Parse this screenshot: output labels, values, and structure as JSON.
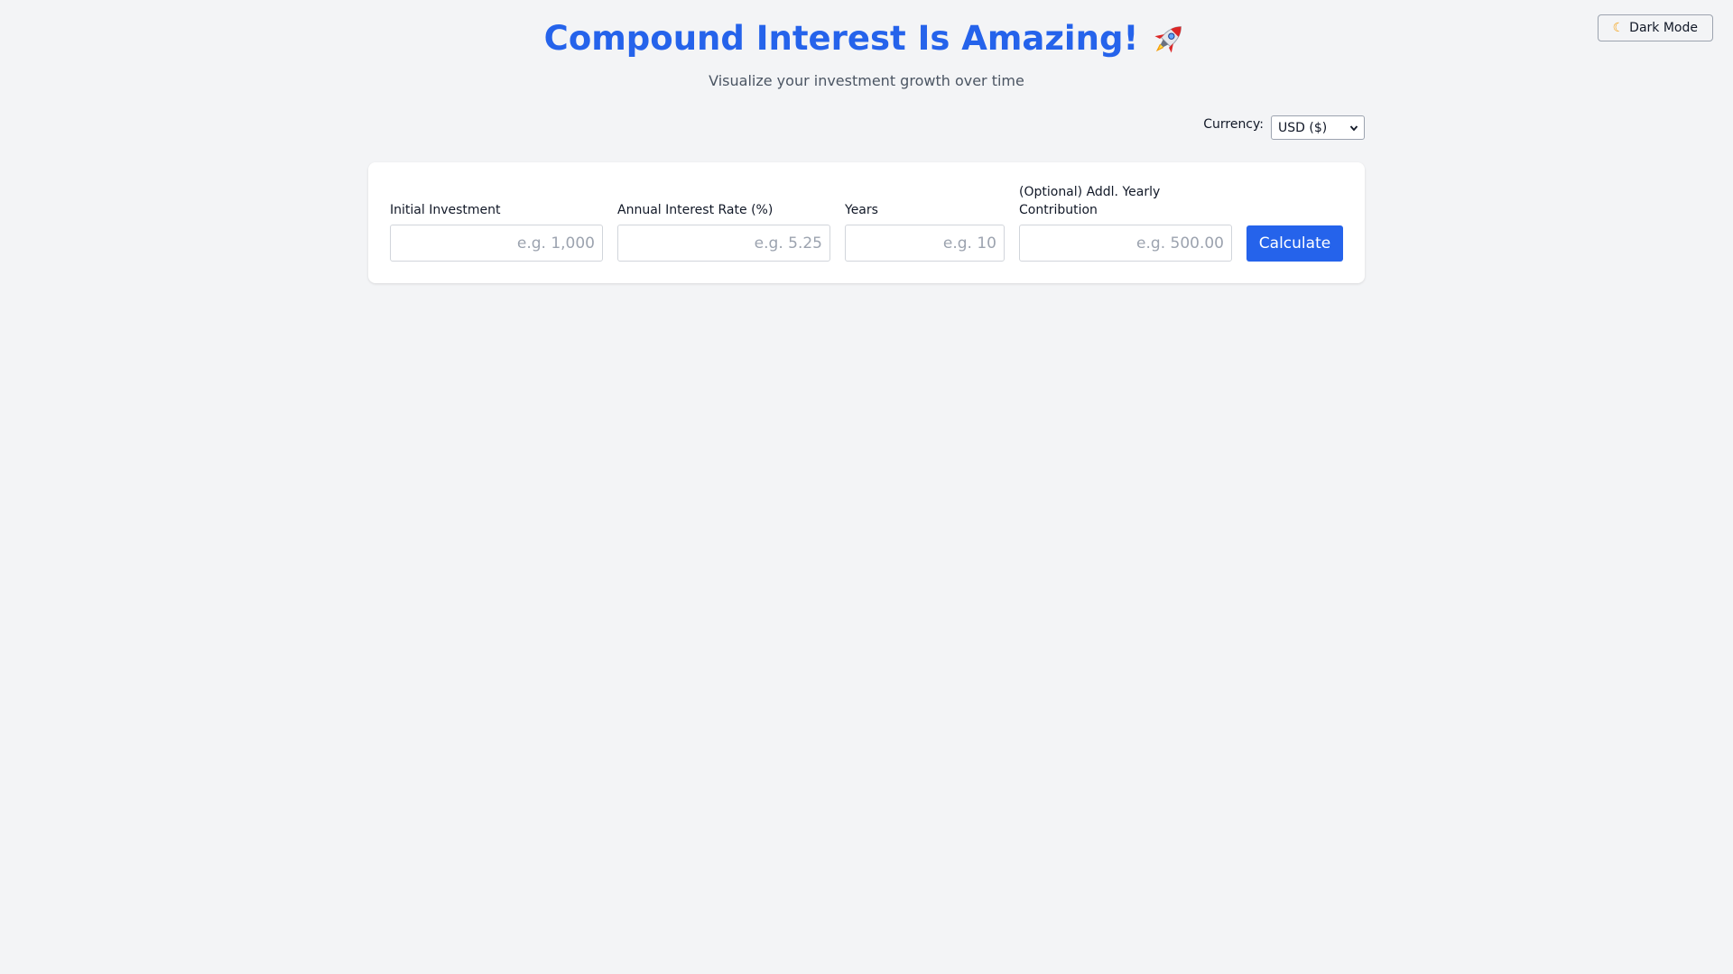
{
  "header": {
    "title": "Compound Interest Is Amazing!",
    "title_icon": "rocket-icon",
    "subtitle": "Visualize your investment growth over time"
  },
  "theme_toggle": {
    "icon": "moon-icon",
    "label": "Dark Mode"
  },
  "currency": {
    "label": "Currency:",
    "selected": "USD ($)"
  },
  "form": {
    "initial_investment": {
      "label": "Initial Investment",
      "placeholder": "e.g. 1,000",
      "value": ""
    },
    "interest_rate": {
      "label": "Annual Interest Rate (%)",
      "placeholder": "e.g. 5.25",
      "value": ""
    },
    "years": {
      "label": "Years",
      "placeholder": "e.g. 10",
      "value": ""
    },
    "contribution": {
      "label": "(Optional) Addl. Yearly Contribution",
      "placeholder": "e.g. 500.00",
      "value": ""
    },
    "submit_label": "Calculate"
  },
  "colors": {
    "accent": "#2563eb",
    "background": "#f3f4f6",
    "card": "#ffffff"
  }
}
